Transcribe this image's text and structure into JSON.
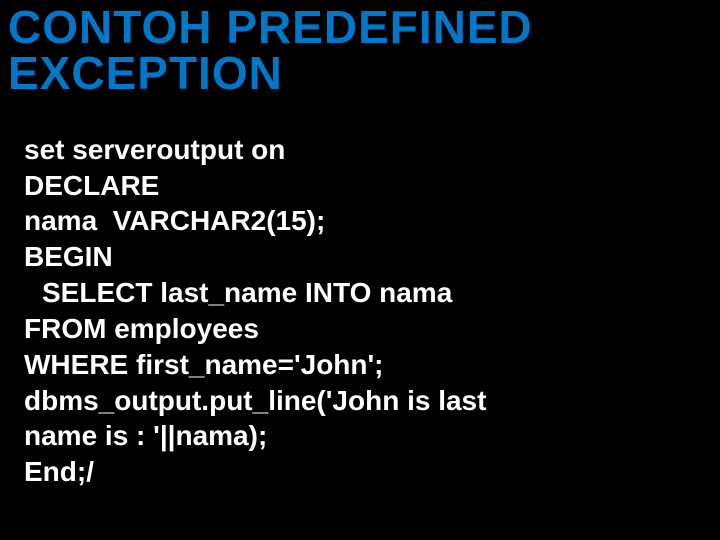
{
  "title_line1": "CONTOH PREDEFINED",
  "title_line2": "EXCEPTION",
  "code": {
    "l1": "set serveroutput on",
    "l2": "DECLARE",
    "l3": "nama  VARCHAR2(15);",
    "l4": "BEGIN",
    "l5": "SELECT last_name INTO nama",
    "l6": "FROM employees",
    "l7": "WHERE first_name='John';",
    "l8": "dbms_output.put_line('John is last",
    "l9": "name is : '||nama);",
    "l10": "End;/"
  }
}
